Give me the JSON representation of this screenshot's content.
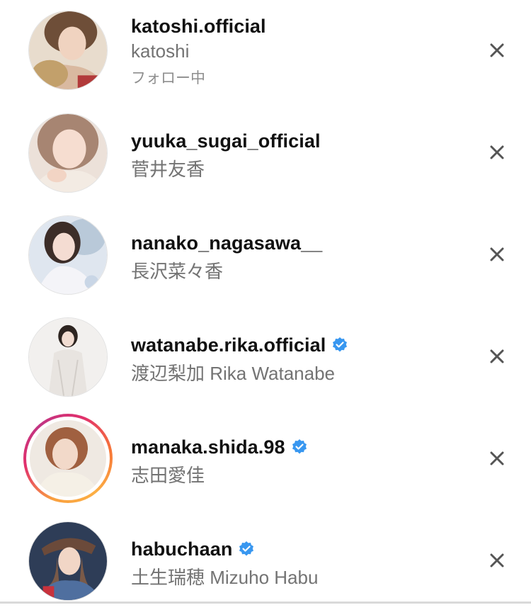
{
  "colors": {
    "username": "#111111",
    "subtitle": "#737373",
    "verified_badge": "#3897f0",
    "remove_icon": "#555555",
    "story_ring": [
      "#f9a03f",
      "#e1306c",
      "#c13584"
    ]
  },
  "accounts": [
    {
      "username": "katoshi.official",
      "display_name": "katoshi",
      "status": "フォロー中",
      "verified": false,
      "has_story": false,
      "avatar_icon": "profile-photo"
    },
    {
      "username": "yuuka_sugai_official",
      "display_name": "菅井友香",
      "verified": false,
      "has_story": false,
      "avatar_icon": "profile-photo"
    },
    {
      "username": "nanako_nagasawa__",
      "display_name": "長沢菜々香",
      "verified": false,
      "has_story": false,
      "avatar_icon": "profile-photo"
    },
    {
      "username": "watanabe.rika.official",
      "display_name": "渡辺梨加 Rika Watanabe",
      "verified": true,
      "has_story": false,
      "avatar_icon": "profile-photo"
    },
    {
      "username": "manaka.shida.98",
      "display_name": "志田愛佳",
      "verified": true,
      "has_story": true,
      "avatar_icon": "profile-photo"
    },
    {
      "username": "habuchaan",
      "display_name": "土生瑞穂  Mizuho Habu",
      "verified": true,
      "has_story": false,
      "avatar_icon": "profile-photo"
    }
  ],
  "icons": {
    "remove": "close-icon",
    "verified": "verified-badge-icon"
  }
}
